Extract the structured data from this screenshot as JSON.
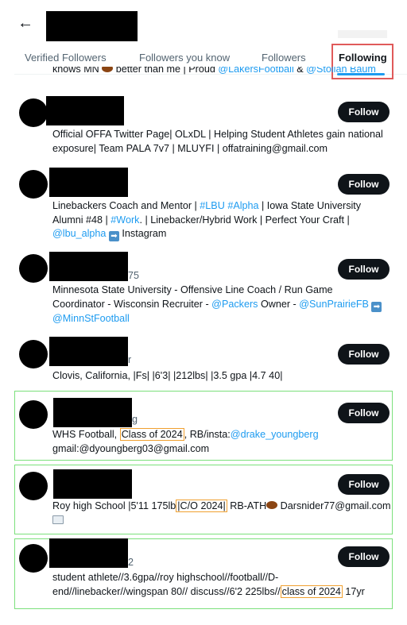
{
  "header": {
    "back_icon": "arrow-left-icon"
  },
  "tabs": [
    {
      "label": "Verified Followers"
    },
    {
      "label": "Followers you know"
    },
    {
      "label": "Followers"
    },
    {
      "label": "Following",
      "active": true
    }
  ],
  "top_clipped_bio": {
    "pre": "knows MN ",
    "mid": " better than me | Proud ",
    "link1": "@LakersFootball",
    "amp": " & ",
    "link2": "@Stollan Baum"
  },
  "follow_label": "Follow",
  "accounts": [
    {
      "bio_lines": [
        "Official OFFA Twitter Page| OLxDL | Helping Student Athletes gain national",
        "exposure| Team PALA 7v7 | MLUYFI | offatraining@gmail.com"
      ]
    },
    {
      "bio": {
        "t1": "Linebackers Coach and Mentor | ",
        "h1": "#LBU",
        "sp": " ",
        "h2": "#Alpha",
        "t2": " | Iowa State University",
        "t3": "Alumni #48 | ",
        "h3": "#Work",
        "t4": ". | Linebacker/Hybrid Work | Perfect Your Craft |",
        "m1": "@lbu_alpha",
        "t5": " Instagram"
      }
    },
    {
      "handle_fragment": "75",
      "bio": {
        "t1": "Minnesota State University - Offensive Line Coach / Run Game",
        "t2": "Coordinator - Wisconsin Recruiter - ",
        "m1": "@Packers",
        "t3": " Owner - ",
        "m2": "@SunPrairieFB",
        "m3": "@MinnStFootball"
      }
    },
    {
      "handle_fragment": "r",
      "bio_lines": [
        "Clovis, California, |Fs| |6'3| |212lbs| |3.5 gpa |4.7 40|"
      ]
    },
    {
      "handle_fragment": "g",
      "bio": {
        "t1": "WHS Football, ",
        "hl": "Class of 2024",
        "t2": ", RB/insta:",
        "m1": "@drake_youngberg",
        "t3": "gmail:@dyoungberg03@gmail.com"
      }
    },
    {
      "bio": {
        "t1": "Roy high School |5'11 175lb",
        "hl": "|C/O 2024|",
        "t2": " RB-ATH",
        "t3": " Darsnider77@gmail.com"
      }
    },
    {
      "handle_fragment": "2",
      "bio": {
        "t1": "student athlete//3.6gpa//roy highschool//football//D-",
        "t2": "end//linebacker//wingspan 80// discuss//6'2 225lbs//",
        "hl": "class of 2024",
        "t3": " 17yr"
      }
    }
  ],
  "colors": {
    "link": "#1d9bf0",
    "button_bg": "#0f1419",
    "highlight_green": "#7be07b",
    "highlight_orange": "#f0a030",
    "highlight_red": "#e05a5a"
  }
}
